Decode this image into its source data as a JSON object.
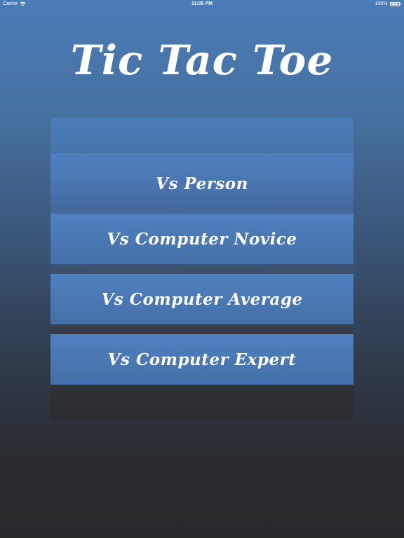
{
  "status_bar": {
    "carrier": "Carrier",
    "wifi_icon": "wifi-icon",
    "time": "11:05 PM",
    "battery_percent": "100%",
    "battery_icon": "battery-icon",
    "battery_level": 1.0
  },
  "title": "Tic Tac Toe",
  "menu": {
    "buttons": [
      {
        "label": "Vs Person"
      },
      {
        "label": "Vs Computer Novice"
      },
      {
        "label": "Vs Computer Average"
      },
      {
        "label": "Vs Computer Expert"
      }
    ]
  },
  "colors": {
    "background_top": "#4a7cb9",
    "background_bottom": "#28292b",
    "button": "#4a78b4",
    "text": "#ffffff"
  }
}
